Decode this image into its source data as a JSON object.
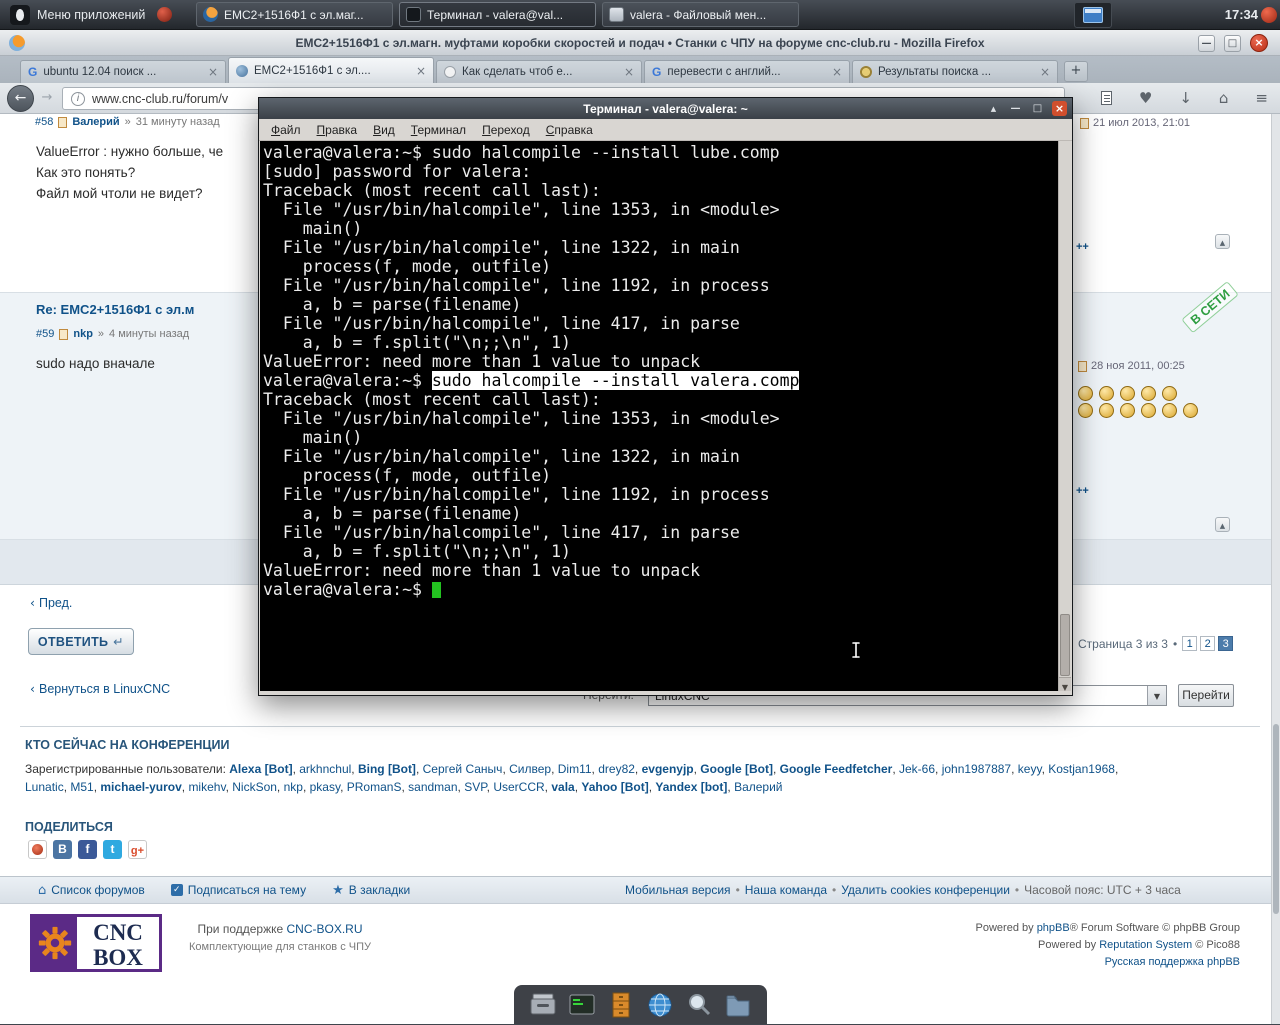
{
  "panel": {
    "menu_label": "Меню приложений",
    "clock": "17:34",
    "tasks": [
      {
        "label": "EMC2+1516Ф1 с эл.маг...",
        "icon": "firefox",
        "active": false
      },
      {
        "label": "Терминал - valera@val...",
        "icon": "terminal",
        "active": true
      },
      {
        "label": "valera - Файловый мен...",
        "icon": "file-manager",
        "active": false
      }
    ]
  },
  "browser": {
    "window_title": "EMC2+1516Ф1 с эл.магн. муфтами коробки скоростей и подач • Станки с ЧПУ на форуме cnc-club.ru - Mozilla Firefox",
    "url": "www.cnc-club.ru/forum/v",
    "tabs": [
      {
        "label": "ubuntu 12.04 поиск ...",
        "favicon": "google",
        "active": false
      },
      {
        "label": "EMC2+1516Ф1 с эл....",
        "favicon": "globe",
        "active": true
      },
      {
        "label": "Как сделать чтоб е...",
        "favicon": "circle",
        "active": false
      },
      {
        "label": "перевести с англий...",
        "favicon": "google",
        "active": false
      },
      {
        "label": "Результаты поиска ...",
        "favicon": "gear",
        "active": false
      }
    ],
    "nav_icons": [
      "copy-page-icon",
      "bookmark-heart-icon",
      "download-icon",
      "home-icon",
      "menu-icon"
    ]
  },
  "terminal": {
    "title": "Терминал - valera@valera: ~",
    "menu": [
      "Файл",
      "Правка",
      "Вид",
      "Терминал",
      "Переход",
      "Справка"
    ],
    "lines": [
      {
        "text": "valera@valera:~$ sudo halcompile --install lube.comp"
      },
      {
        "text": "[sudo] password for valera: "
      },
      {
        "text": "Traceback (most recent call last):"
      },
      {
        "text": "  File \"/usr/bin/halcompile\", line 1353, in <module>"
      },
      {
        "text": "    main()"
      },
      {
        "text": "  File \"/usr/bin/halcompile\", line 1322, in main"
      },
      {
        "text": "    process(f, mode, outfile)"
      },
      {
        "text": "  File \"/usr/bin/halcompile\", line 1192, in process"
      },
      {
        "text": "    a, b = parse(filename)"
      },
      {
        "text": "  File \"/usr/bin/halcompile\", line 417, in parse"
      },
      {
        "text": "    a, b = f.split(\"\\n;;\\n\", 1)"
      },
      {
        "text": "ValueError: need more than 1 value to unpack"
      },
      {
        "prefix": "valera@valera:~$ ",
        "highlight": "sudo halcompile --install valera.comp"
      },
      {
        "text": "Traceback (most recent call last):"
      },
      {
        "text": "  File \"/usr/bin/halcompile\", line 1353, in <module>"
      },
      {
        "text": "    main()"
      },
      {
        "text": "  File \"/usr/bin/halcompile\", line 1322, in main"
      },
      {
        "text": "    process(f, mode, outfile)"
      },
      {
        "text": "  File \"/usr/bin/halcompile\", line 1192, in process"
      },
      {
        "text": "    a, b = parse(filename)"
      },
      {
        "text": "  File \"/usr/bin/halcompile\", line 417, in parse"
      },
      {
        "text": "    a, b = f.split(\"\\n;;\\n\", 1)"
      },
      {
        "text": "ValueError: need more than 1 value to unpack"
      },
      {
        "prefix": "valera@valera:~$ ",
        "cursor": true
      }
    ]
  },
  "forum": {
    "meta_sep": "»",
    "post_above": {
      "number": "#58",
      "author": "Валерий",
      "time": "31 минуту назад",
      "lines": [
        "ValueError : нужно больше, че",
        "Как это понять?",
        "Файл мой чтоли не видет?"
      ]
    },
    "post_current": {
      "title": "Re: EMC2+1516Ф1 с эл.м",
      "number": "#59",
      "author": "nkp",
      "time": "4 минуты назад",
      "body": "sudo надо вначале"
    },
    "dates": [
      "21 июл 2013, 21:01",
      "28 ноя 2011, 00:25"
    ],
    "online_badge": "В СЕТИ",
    "plus_plus": "++",
    "medal_rows": [
      5,
      6
    ],
    "prev_link": "Пред.",
    "reply_button": "ОТВЕТИТЬ",
    "return_link": "Вернуться в LinuxCNC",
    "pagination": {
      "label": "Страница 3 из 3",
      "bullet": "•",
      "pages": [
        "1",
        "2",
        "3"
      ],
      "active": "3"
    },
    "jump": {
      "label": "Перейти:",
      "value": "LinuxCNC",
      "button": "Перейти"
    },
    "who_heading": "КТО СЕЙЧАС НА КОНФЕРЕНЦИИ",
    "who_label": "Зарегистрированные пользователи:",
    "users": [
      {
        "name": "Alexa [Bot]",
        "bold": true
      },
      {
        "name": "arkhnchul"
      },
      {
        "name": "Bing [Bot]",
        "bold": true
      },
      {
        "name": "Сергей Саныч"
      },
      {
        "name": "Силвер"
      },
      {
        "name": "Dim11"
      },
      {
        "name": "drey82"
      },
      {
        "name": "evgenyjp",
        "bold": true
      },
      {
        "name": "Google [Bot]",
        "bold": true
      },
      {
        "name": "Google Feedfetcher",
        "bold": true
      },
      {
        "name": "Jek-66"
      },
      {
        "name": "john1987887"
      },
      {
        "name": "keyy"
      },
      {
        "name": "Kostjan1968",
        "break_after": true
      },
      {
        "name": "Lunatic"
      },
      {
        "name": "M51"
      },
      {
        "name": "michael-yurov",
        "bold": true
      },
      {
        "name": "mikehv"
      },
      {
        "name": "NickSon"
      },
      {
        "name": "nkp"
      },
      {
        "name": "pkasy"
      },
      {
        "name": "PRomanS"
      },
      {
        "name": "sandman"
      },
      {
        "name": "SVP"
      },
      {
        "name": "UserCCR"
      },
      {
        "name": "vala",
        "bold": true
      },
      {
        "name": "Yahoo [Bot]",
        "bold": true
      },
      {
        "name": "Yandex [bot]",
        "bold": true
      },
      {
        "name": "Валерий"
      }
    ],
    "share_heading": "ПОДЕЛИТЬСЯ",
    "share_icons": [
      "mailru",
      "vk",
      "facebook",
      "twitter",
      "googleplus"
    ],
    "footer_links": [
      "Список форумов",
      "Подписаться на тему",
      "В закладки"
    ],
    "footer_sep": "•",
    "footer_right": [
      {
        "label": "Мобильная версия",
        "link": true
      },
      {
        "label": "Наша команда",
        "link": true
      },
      {
        "label": "Удалить cookies конференции",
        "link": true
      },
      {
        "label": "Часовой пояс: UTC + 3 часа",
        "link": false
      }
    ],
    "cnc": {
      "big1": "CNC",
      "big2": "BOX",
      "support_prefix": "При поддержке ",
      "support_link": "CNC-BOX.RU",
      "support_sub": "Комплектующие для станков с ЧПУ"
    },
    "powered_lines": [
      [
        {
          "t": "Powered by "
        },
        {
          "t": "phpBB",
          "link": true
        },
        {
          "t": "® Forum Software © phpBB Group"
        }
      ],
      [
        {
          "t": "Powered by "
        },
        {
          "t": "Reputation System",
          "link": true
        },
        {
          "t": " © Pico88"
        }
      ],
      [
        {
          "t": "Русская поддержка phpBB",
          "link": true
        }
      ]
    ]
  },
  "dock": [
    "drawer-icon",
    "terminal-icon",
    "file-cabinet-icon",
    "web-browser-icon",
    "search-icon",
    "folder-icon"
  ]
}
